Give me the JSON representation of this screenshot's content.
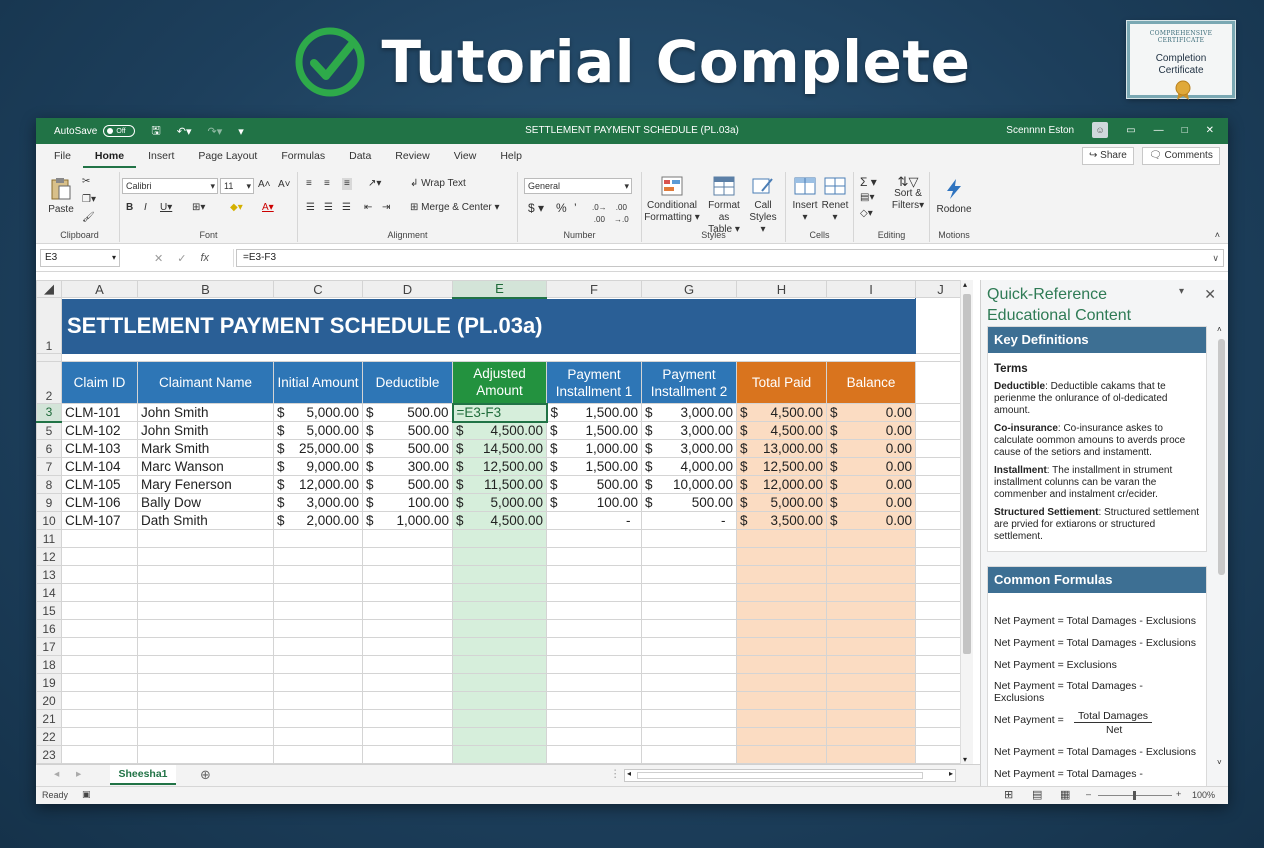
{
  "banner": {
    "title": "Tutorial Complete"
  },
  "certificate": {
    "top_text": "COMPREHENSIVE CERTIFICATE",
    "label_line1": "Completion",
    "label_line2": "Certificate"
  },
  "window": {
    "autosave_label": "AutoSave",
    "autosave_state": "Off",
    "title": "SETTLEMENT PAYMENT SCHEDULE   (PL.03a)",
    "user_name": "Scennnn Eston"
  },
  "menu": {
    "tabs": [
      "File",
      "Home",
      "Insert",
      "Page Layout",
      "Formulas",
      "Data",
      "Review",
      "View",
      "Help"
    ],
    "share": "Share",
    "comments": "Comments"
  },
  "ribbon": {
    "paste": "Paste",
    "font_name": "Calibri",
    "font_size": "11",
    "wrap_text": "Wrap Text",
    "merge_center": "Merge & Center",
    "number_format": "General",
    "conditional_formatting": [
      "Conditional",
      "Formatting"
    ],
    "format_as_table": [
      "Format as",
      "Table"
    ],
    "cell_styles": [
      "Call",
      "Styles"
    ],
    "insert": "Insert",
    "delete": "Renet",
    "sort_filter": [
      "Sort &",
      "Filters"
    ],
    "extra": "Rodone",
    "groups": [
      "Clipboard",
      "Font",
      "Alignment",
      "Number",
      "Styles",
      "Cells",
      "Editing",
      "Motions"
    ]
  },
  "formula_bar": {
    "name_box": "E3",
    "formula": "=E3-F3"
  },
  "columns": [
    "A",
    "B",
    "C",
    "D",
    "E",
    "F",
    "G",
    "H",
    "I",
    "J"
  ],
  "sheet": {
    "title": "SETTLEMENT PAYMENT SCHEDULE (PL.03a)",
    "headers": [
      "Claim ID",
      "Claimant Name",
      "Initial Amount",
      "Deductible",
      "Adjusted Amount",
      "Payment Installment 1",
      "Payment Installment 2",
      "Total Paid",
      "Balance"
    ],
    "rows": [
      {
        "num": "3",
        "id": "CLM-101",
        "name": "John Smith",
        "initial": "$5,000.00",
        "deductible": "$500.00",
        "adjusted": "=E3-F3",
        "p1": "$1,500.00",
        "p2": "$3,000.00",
        "total": "$4,500.00",
        "balance": "$0.00"
      },
      {
        "num": "5",
        "id": "CLM-102",
        "name": "John Smith",
        "initial": "5,000.00",
        "deductible": "500.00",
        "adjusted": "$4,500.00",
        "p1": "1,500.00",
        "p2": "3,000.00",
        "total": "$4,500.00",
        "balance": "$0.00"
      },
      {
        "num": "6",
        "id": "CLM-103",
        "name": "Mark Smith",
        "initial": "25,000.00",
        "deductible": "500.00",
        "adjusted": "14,500.00",
        "p1": "1,000.00",
        "p2": "3,000.00",
        "total": "13,000.00",
        "balance": "$0.00"
      },
      {
        "num": "7",
        "id": "CLM-104",
        "name": "Marc Wanson",
        "initial": "9,000.00",
        "deductible": "300.00",
        "adjusted": "12,500.00",
        "p1": "1,500.00",
        "p2": "4,000.00",
        "total": "12,500.00",
        "balance": "$0.00"
      },
      {
        "num": "8",
        "id": "CLM-105",
        "name": "Mary Fenerson",
        "initial": "12,000.00",
        "deductible": "500.00",
        "adjusted": "11,500.00",
        "p1": "500.00",
        "p2": "10,000.00",
        "total": "12,000.00",
        "balance": "$0.00"
      },
      {
        "num": "9",
        "id": "CLM-106",
        "name": "Bally Dow",
        "initial": "3,000.00",
        "deductible": "100.00",
        "adjusted": "5,000.00",
        "p1": "100.00",
        "p2": "500.00",
        "total": "5,000.00",
        "balance": "$0.00"
      },
      {
        "num": "10",
        "id": "CLM-107",
        "name": "Dath Smith",
        "initial": "2,000.00",
        "deductible": "1,000.00",
        "adjusted": "4,500.00",
        "p1": "-",
        "p2": "-",
        "total": "3,500.00",
        "balance": "$0.00"
      }
    ],
    "empty_rows": [
      "11",
      "12",
      "13",
      "14",
      "15",
      "16",
      "17",
      "18",
      "19",
      "20",
      "21",
      "22",
      "23"
    ],
    "currency": "$"
  },
  "sheet_tab": "Sheesha1",
  "status": {
    "ready": "Ready",
    "zoom": "100%"
  },
  "pane": {
    "title_line1": "Quick-Reference",
    "title_line2": "Educational Content",
    "definitions_header": "Key Definitions",
    "terms_label": "Terms",
    "definitions": [
      {
        "term": "Deductible",
        "text": ": Deductible cakams that te perienme the onlurance of ol-dedicated amount."
      },
      {
        "term": "Co-insurance",
        "text": ": Co-insurance askes to calculate oommon amouns to averds proce cause of the setiors and instamentt."
      },
      {
        "term": "Installment",
        "text": ": The installment in strument installment colunns can be varan the commenber and instalment cr/ecider."
      },
      {
        "term": "Structured Settiement",
        "text": ":  Structured settlement are prvied for extiarons or structured settlement."
      }
    ],
    "formulas_header": "Common Formulas",
    "formulas": [
      "Net Payment = Total Damages - Exclusions",
      "Net Payment = Total Damages - Exclusions",
      "Net Payment = Exclusions",
      "Net Payment = Total Damages -",
      "Exclusions",
      "Net Payment =",
      "Total Damages",
      "Net",
      "Net Payment = Total Damages - Exclusions",
      "Net Payment = Total Damages -"
    ]
  },
  "colors": {
    "excel_green": "#217346",
    "header_blue": "#2e76b6",
    "title_blue": "#2a5f96",
    "adjusted_green": "#23923f",
    "total_orange": "#d9741e"
  }
}
